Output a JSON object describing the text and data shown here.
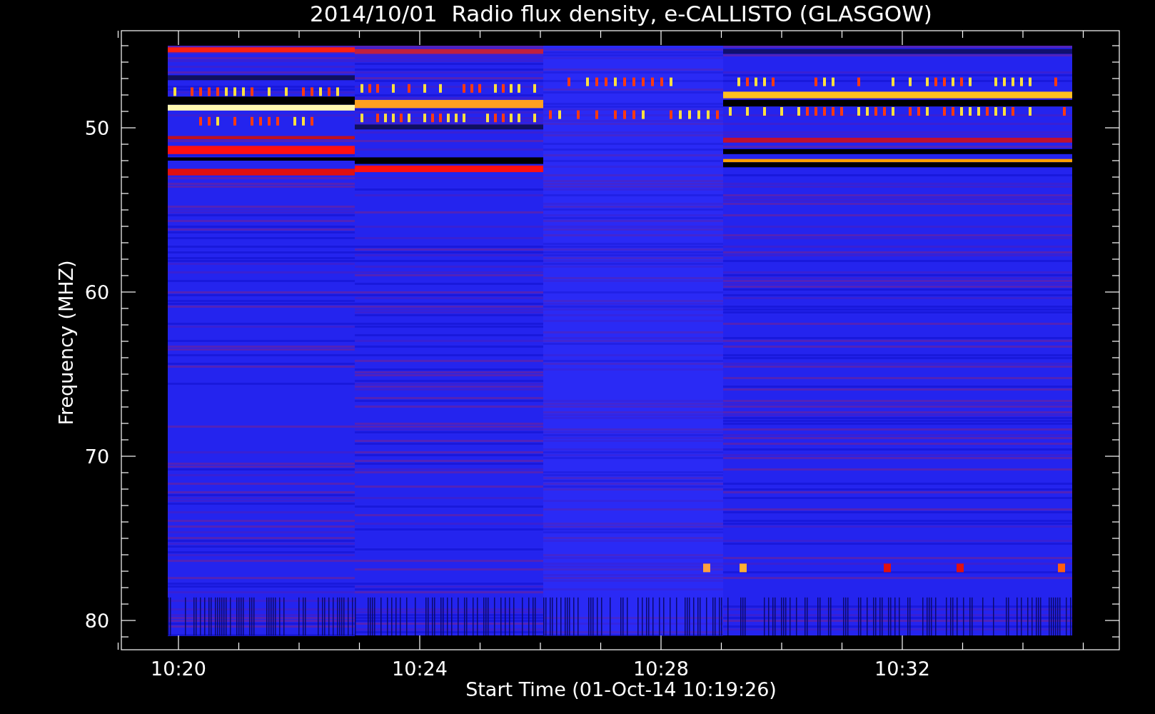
{
  "title": "2014/10/01  Radio flux density, e-CALLISTO (GLASGOW)",
  "ylabel": "Frequency (MHZ)",
  "xlabel": "Start Time (01-Oct-14 10:19:26)",
  "yticks": [
    "50",
    "60",
    "70",
    "80"
  ],
  "xticks": [
    "10:20",
    "10:24",
    "10:28",
    "10:32"
  ]
}
